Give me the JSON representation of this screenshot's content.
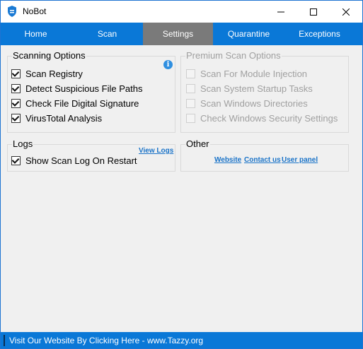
{
  "window": {
    "title": "NoBot"
  },
  "nav": {
    "tabs": [
      "Home",
      "Scan",
      "Settings",
      "Quarantine",
      "Exceptions"
    ],
    "active": "Settings"
  },
  "scanning_options": {
    "title": "Scanning Options",
    "items": [
      {
        "label": "Scan Registry",
        "checked": true
      },
      {
        "label": "Detect Suspicious File Paths",
        "checked": true
      },
      {
        "label": "Check File Digital Signature",
        "checked": true
      },
      {
        "label": "VirusTotal Analysis",
        "checked": true
      }
    ]
  },
  "premium_options": {
    "title": "Premium Scan Options",
    "items": [
      {
        "label": "Scan For Module Injection",
        "checked": false
      },
      {
        "label": "Scan System Startup Tasks",
        "checked": false
      },
      {
        "label": "Scan Windows Directories",
        "checked": false
      },
      {
        "label": "Check Windows Security Settings",
        "checked": false
      }
    ]
  },
  "logs": {
    "title": "Logs",
    "show_log_label": "Show Scan Log On Restart",
    "show_log_checked": true,
    "view_logs": "View Logs"
  },
  "other": {
    "title": "Other",
    "links": [
      "Website",
      "Contact us",
      "User panel"
    ]
  },
  "status": {
    "text": "Visit Our Website By Clicking Here - www.Tazzy.org"
  },
  "colors": {
    "accent": "#0a78d7",
    "active_tab": "#7a7a7a",
    "link": "#1a73c8"
  }
}
